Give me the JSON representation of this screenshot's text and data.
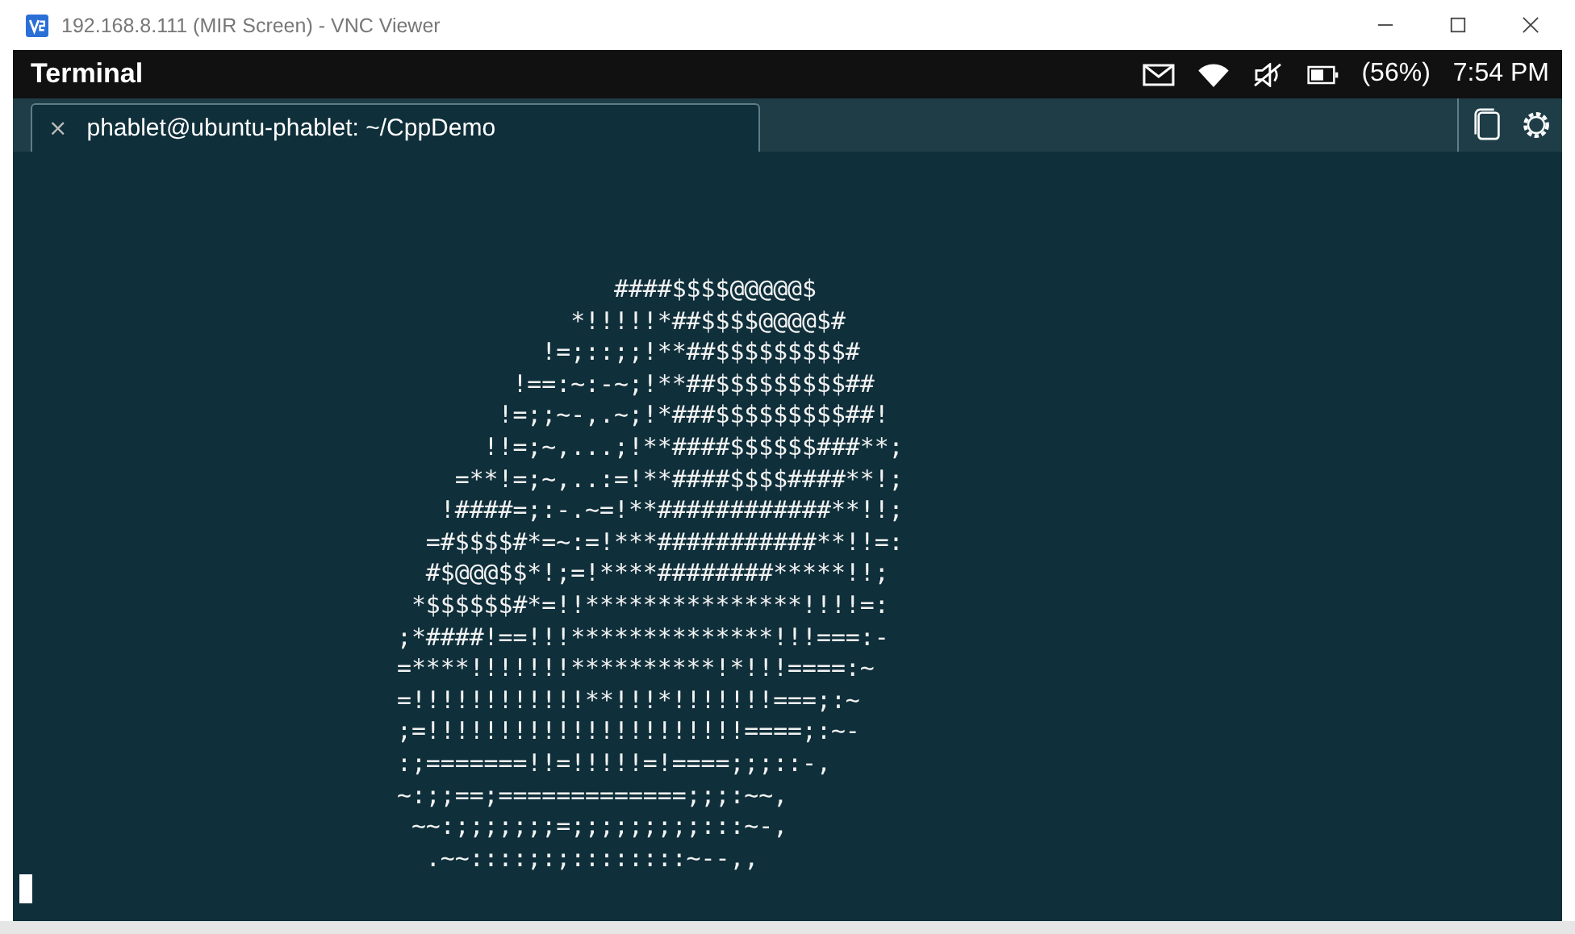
{
  "window": {
    "title": "192.168.8.111 (MIR Screen) - VNC Viewer"
  },
  "status_bar": {
    "app_title": "Terminal",
    "battery": "(56%)",
    "time": "7:54 PM"
  },
  "tabs": [
    {
      "close": "×",
      "label": "phablet@ubuntu-phablet: ~/CppDemo",
      "selected": true
    }
  ],
  "terminal": {
    "lines": [
      "               ####$$$$@@@@@$",
      "            *!!!!!*##$$$$@@@@$#",
      "          !=;::;;!**##$$$$$$$$$#",
      "        !==:~:-~;!**##$$$$$$$$$##",
      "       !=;;~-,.~;!*###$$$$$$$$$##!",
      "      !!=;~,...;!**####$$$$$$###**;",
      "    =**!=;~,..:=!**####$$$$####**!;",
      "   !####=;:-.~=!**############**!!;",
      "  =#$$$$#*=~:=!***###########**!!=:",
      "  #$@@@$$*!;=!****########*****!!;",
      " *$$$$$$#*=!!***************!!!!=:",
      ";*####!==!!!**************!!!===:-",
      "=****!!!!!!!**********!*!!!====:~",
      "=!!!!!!!!!!!!**!!!*!!!!!!!===;:~",
      ";=!!!!!!!!!!!!!!!!!!!!!!====;:~-",
      ":;=======!!=!!!!!=!====;;;::-,",
      "~:;;==;=============;;;:~~,",
      " ~~:;;;;;;;=;;;;;;;;;:::~-,",
      "  .~~::::;:;::::::::~--,,"
    ]
  }
}
